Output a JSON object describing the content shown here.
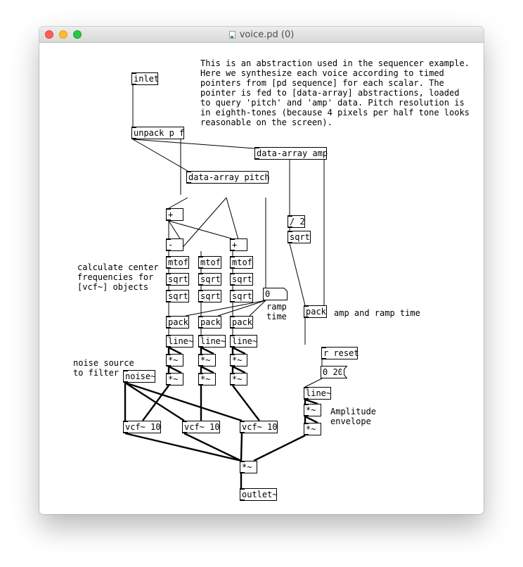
{
  "window": {
    "title": "voice.pd (0)"
  },
  "objects": {
    "inlet": "inlet",
    "unpack": "unpack p f",
    "data_array_amp": "data-array amp",
    "data_array_pitch": "data-array pitch",
    "plus1": "+",
    "minus": "-",
    "plus2": "+",
    "div2": "/ 2",
    "sqrt_amp": "sqrt",
    "mtof1": "mtof",
    "mtof2": "mtof",
    "mtof3": "mtof",
    "sqrt1a": "sqrt",
    "sqrt1b": "sqrt",
    "sqrt2a": "sqrt",
    "sqrt2b": "sqrt",
    "sqrt3a": "sqrt",
    "sqrt3b": "sqrt",
    "pack1": "pack",
    "pack2": "pack",
    "pack3": "pack",
    "pack_amp": "pack",
    "line1": "line~",
    "line2": "line~",
    "line3": "line~",
    "line_amp": "line~",
    "mul1a": "*~",
    "mul1b": "*~",
    "mul2a": "*~",
    "mul2b": "*~",
    "mul3a": "*~",
    "mul3b": "*~",
    "mul_amp_a": "*~",
    "mul_amp_b": "*~",
    "noise": "noise~",
    "vcf1": "vcf~ 10",
    "vcf2": "vcf~ 10",
    "vcf3": "vcf~ 10",
    "mul_out": "*~",
    "outlet": "outlet~",
    "r_reset": "r reset"
  },
  "messages": {
    "msg_0_20": "0 20"
  },
  "atoms": {
    "ramp_atom": "0"
  },
  "comments": {
    "intro": "This is an abstraction used in the sequencer example.\nHere we synthesize each voice according to timed\npointers from [pd sequence] for each scalar. The\npointer is fed to [data-array] abstractions, loaded\nto query 'pitch' and 'amp' data. Pitch resolution is\nin eighth-tones (because 4 pixels per half tone looks\nreasonable on the screen).",
    "calc_center": "calculate center\nfrequencies for\n[vcf~] objects",
    "ramp_time": "ramp\ntime",
    "amp_ramp": "amp and ramp time",
    "noise_source": "noise source\nto filter",
    "amp_env": "Amplitude\nenvelope"
  }
}
